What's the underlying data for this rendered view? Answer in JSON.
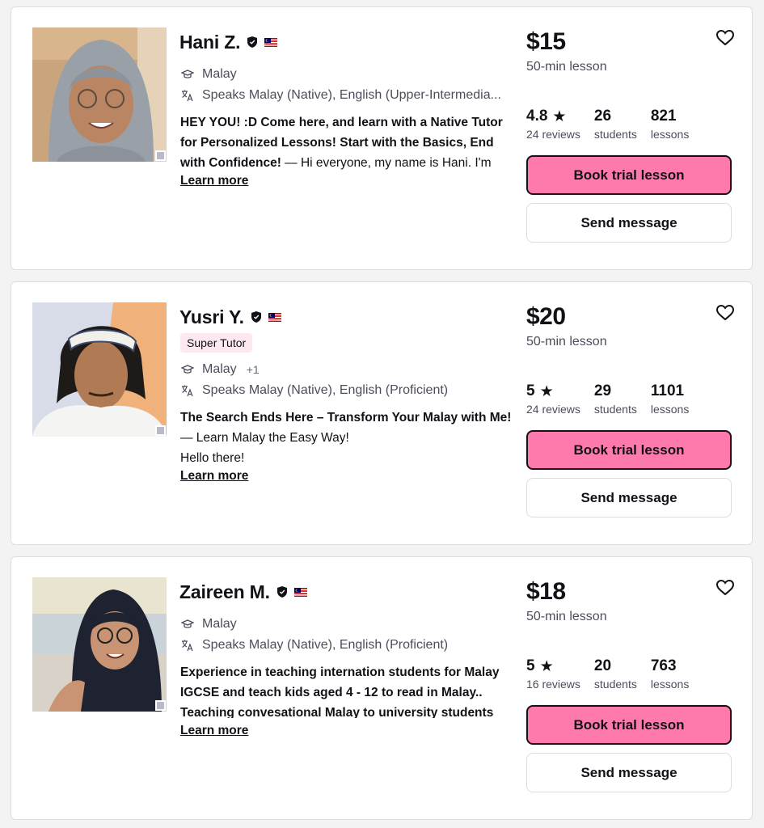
{
  "common": {
    "lesson_length": "50-min lesson",
    "reviews_suffix": "reviews",
    "students_label": "students",
    "lessons_label": "lessons",
    "book_label": "Book trial lesson",
    "message_label": "Send message",
    "learn_more": "Learn more",
    "accent_color": "#ff7aac"
  },
  "tutors": [
    {
      "name": "Hani Z.",
      "subject": "Malay",
      "speaks": "Speaks Malay (Native), English (Upper-Intermedia...",
      "headline": "HEY YOU! :D Come here, and learn with a Native Tutor for Personalized Lessons! Start with the Basics, End with Confidence!",
      "intro": " — Hi everyone, my name is Hani. I'm",
      "price": "$15",
      "rating": "4.8",
      "reviews": "24 reviews",
      "students": "26",
      "lessons": "821"
    },
    {
      "name": "Yusri Y.",
      "badge": "Super Tutor",
      "subject": "Malay",
      "subject_extra": "+1",
      "speaks": "Speaks Malay (Native), English (Proficient)",
      "headline": "The Search Ends Here – Transform Your Malay with Me!",
      "intro": " — Learn Malay the Easy Way!",
      "intro2": "Hello there!",
      "price": "$20",
      "rating": "5",
      "reviews": "24 reviews",
      "students": "29",
      "lessons": "1101"
    },
    {
      "name": "Zaireen M.",
      "subject": "Malay",
      "speaks": "Speaks Malay (Native), English (Proficient)",
      "headline": "Experience in teaching internation students for Malay IGCSE and teach kids aged 4 - 12 to read in Malay.. Teaching convesational Malay to university students",
      "intro": "",
      "price": "$18",
      "rating": "5",
      "reviews": "16 reviews",
      "students": "20",
      "lessons": "763"
    }
  ]
}
